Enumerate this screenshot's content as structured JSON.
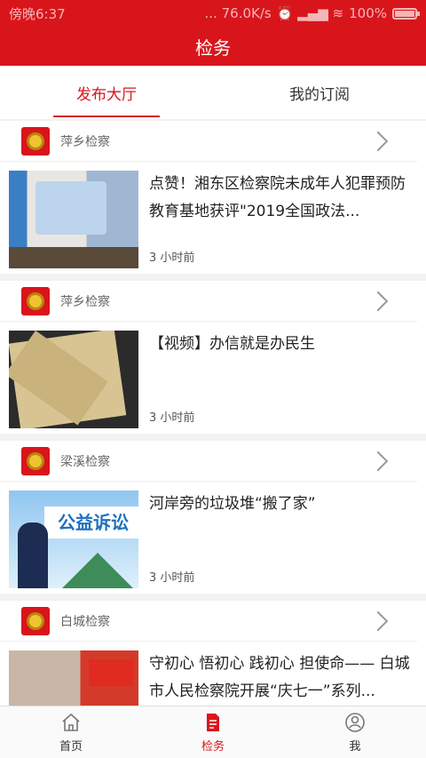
{
  "status_bar": {
    "time": "傍晚6:37",
    "network_speed": "... 76.0K/s",
    "signal": "⏰ ▂▄▆ ≋",
    "battery": "100%"
  },
  "header": {
    "title": "检务"
  },
  "tabs": [
    {
      "label": "发布大厅",
      "active": true
    },
    {
      "label": "我的订阅",
      "active": false
    }
  ],
  "feed": [
    {
      "source": "萍乡检察",
      "title": "点赞！湘东区检察院未成年人犯罪预防教育基地获评\"2019全国政法...",
      "time": "3 小时前"
    },
    {
      "source": "萍乡检察",
      "title": "【视频】办信就是办民生",
      "time": "3 小时前"
    },
    {
      "source": "梁溪检察",
      "title": "河岸旁的垃圾堆“搬了家”",
      "time": "3 小时前"
    },
    {
      "source": "白城检察",
      "title": "守初心 悟初心 践初心 担使命—— 白城市人民检察院开展“庆七一”系列...",
      "time": ""
    }
  ],
  "thumb3_text": "公益诉讼",
  "bottom_nav": [
    {
      "label": "首页",
      "icon": "home-icon",
      "active": false
    },
    {
      "label": "检务",
      "icon": "document-icon",
      "active": true
    },
    {
      "label": "我",
      "icon": "user-icon",
      "active": false
    }
  ],
  "colors": {
    "primary": "#d9151c"
  }
}
